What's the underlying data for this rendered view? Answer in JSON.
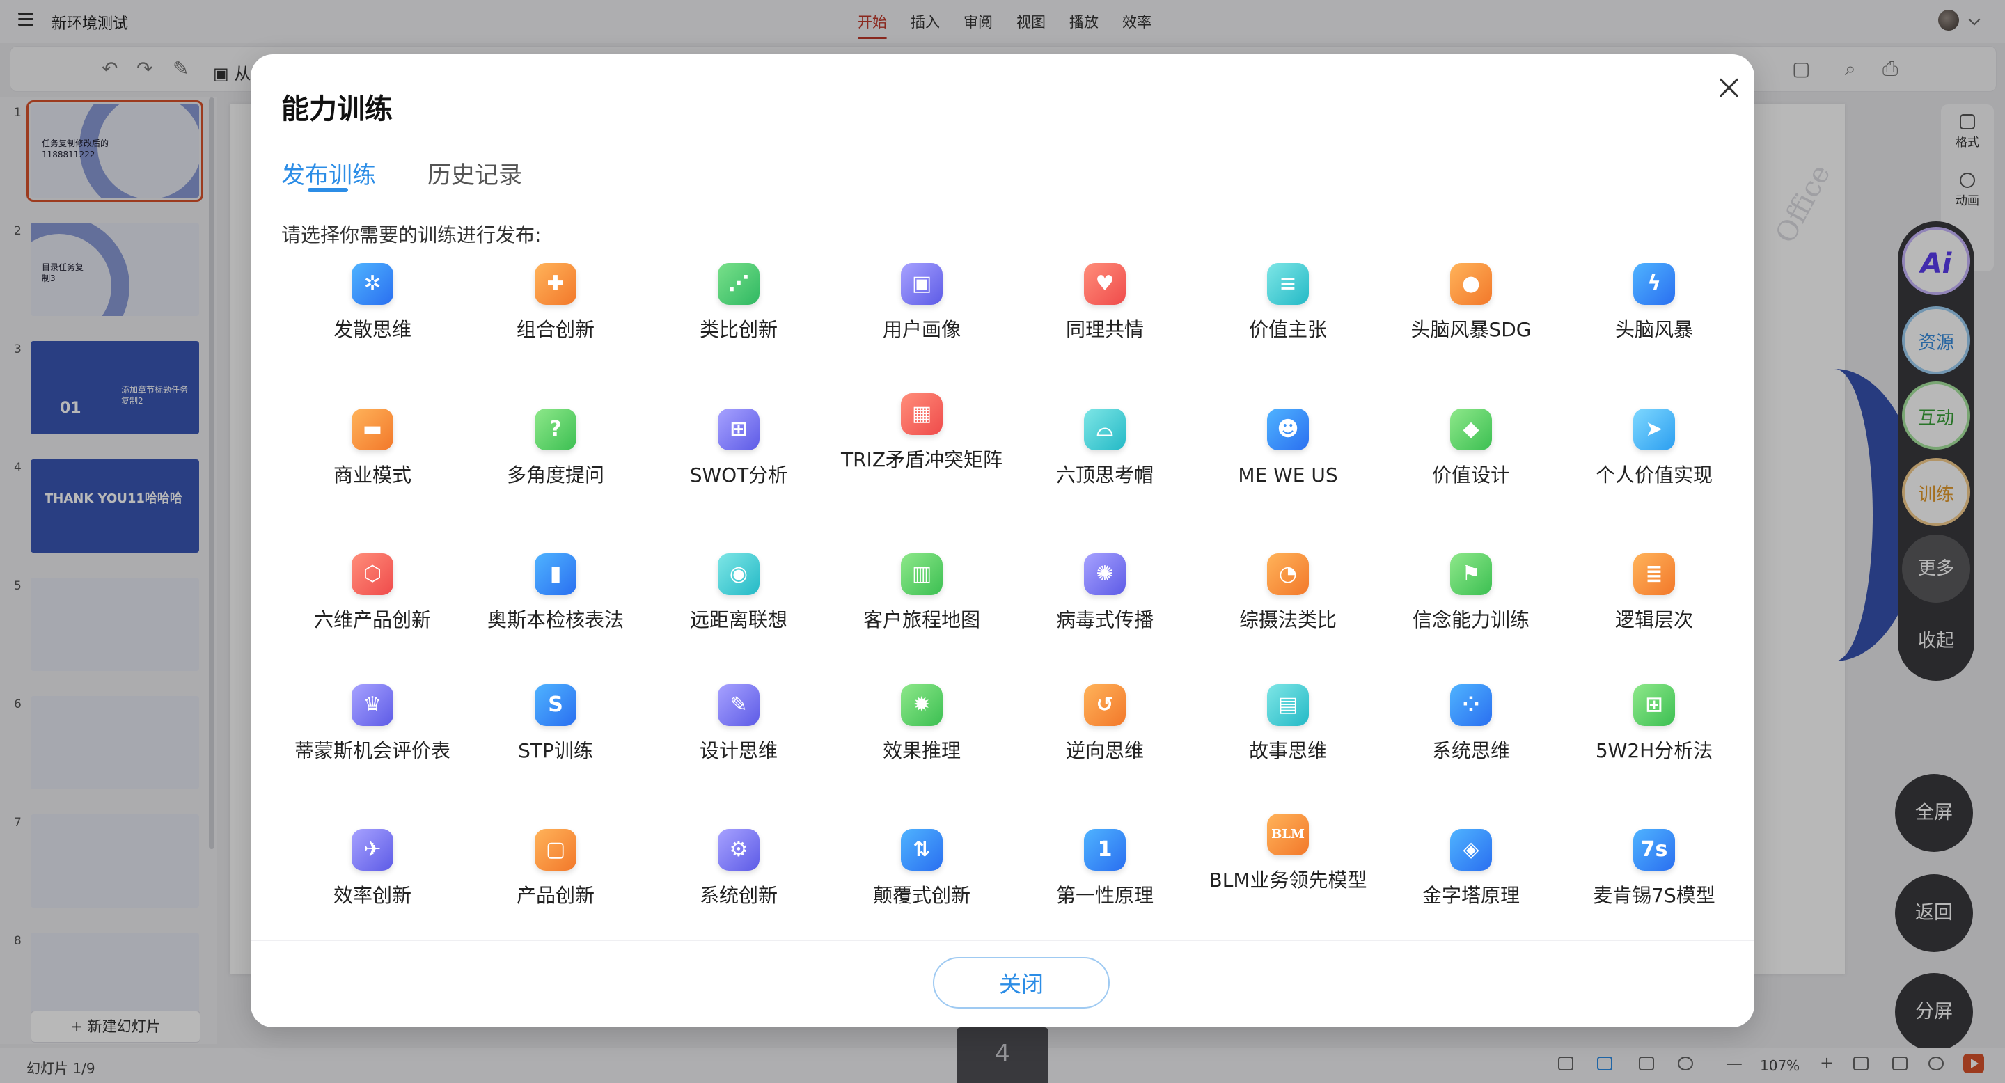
{
  "app": {
    "doc_title": "新环境测试",
    "tabs": [
      "开始",
      "插入",
      "审阅",
      "视图",
      "播放",
      "效率"
    ],
    "active_tab": "开始"
  },
  "toolbar": {
    "partial_label": "从"
  },
  "slides_panel": {
    "thumbnails": [
      {
        "num": "1",
        "text": "任务复制修改后的 1188811222"
      },
      {
        "num": "2",
        "text": "目录任务复制3"
      },
      {
        "num": "3",
        "big": "01",
        "text": "添加章节标题任务复制2"
      },
      {
        "num": "4",
        "big": "THANK YOU11哈哈哈"
      },
      {
        "num": "5",
        "text": ""
      },
      {
        "num": "6",
        "text": ""
      },
      {
        "num": "7",
        "text": ""
      },
      {
        "num": "8",
        "text": ""
      }
    ],
    "new_slide_label": "+ 新建幻灯片"
  },
  "right_panel": {
    "format": "格式",
    "animation": "动画"
  },
  "float_bar": {
    "ai": "Ai",
    "resources": "资源",
    "interact": "互动",
    "training": "训练",
    "more": "更多",
    "collapse": "收起",
    "fullscreen": "全屏",
    "back": "返回",
    "split": "分屏"
  },
  "status_bar": {
    "slide_counter": "幻灯片 1/9",
    "page_tab": "4",
    "zoom": "107%"
  },
  "modal": {
    "title": "能力训练",
    "tab_publish": "发布训练",
    "tab_history": "历史记录",
    "prompt": "请选择你需要的训练进行发布:",
    "close_button": "关闭",
    "items": [
      {
        "label": "发散思维",
        "icon": "network-icon",
        "color": "blue",
        "glyph": "✲"
      },
      {
        "label": "组合创新",
        "icon": "puzzle-icon",
        "color": "orange",
        "glyph": "✚"
      },
      {
        "label": "类比创新",
        "icon": "nodes-icon",
        "color": "green",
        "glyph": "⋰"
      },
      {
        "label": "用户画像",
        "icon": "user-card-icon",
        "color": "purple",
        "glyph": "▣"
      },
      {
        "label": "同理共情",
        "icon": "heart-icon",
        "color": "red",
        "glyph": "♥"
      },
      {
        "label": "价值主张",
        "icon": "database-icon",
        "color": "cyan",
        "glyph": "≡"
      },
      {
        "label": "头脑风暴SDG",
        "icon": "bulb-icon",
        "color": "orange",
        "glyph": "●"
      },
      {
        "label": "头脑风暴",
        "icon": "bolt-icon",
        "color": "blue",
        "glyph": "ϟ"
      },
      {
        "label": "商业模式",
        "icon": "briefcase-icon",
        "color": "orange",
        "glyph": "▬"
      },
      {
        "label": "多角度提问",
        "icon": "question-icon",
        "color": "lime",
        "glyph": "?"
      },
      {
        "label": "SWOT分析",
        "icon": "swot-grid-icon",
        "color": "purple",
        "glyph": "⊞"
      },
      {
        "label": "TRIZ矛盾冲突矩阵",
        "icon": "matrix-icon",
        "color": "red",
        "glyph": "▦"
      },
      {
        "label": "六顶思考帽",
        "icon": "hat-icon",
        "color": "cyan",
        "glyph": "⌓"
      },
      {
        "label": "ME WE US",
        "icon": "group-icon",
        "color": "blue",
        "glyph": "☻"
      },
      {
        "label": "价值设计",
        "icon": "diamond-icon",
        "color": "lime",
        "glyph": "◆"
      },
      {
        "label": "个人价值实现",
        "icon": "paper-plane-icon",
        "color": "sky",
        "glyph": "➤"
      },
      {
        "label": "六维产品创新",
        "icon": "hexagon-icon",
        "color": "red",
        "glyph": "⬡"
      },
      {
        "label": "奥斯本检核表法",
        "icon": "bar-chart-icon",
        "color": "blue",
        "glyph": "▮"
      },
      {
        "label": "远距离联想",
        "icon": "location-pin-icon",
        "color": "cyan",
        "glyph": "◉"
      },
      {
        "label": "客户旅程地图",
        "icon": "map-icon",
        "color": "lime",
        "glyph": "▥"
      },
      {
        "label": "病毒式传播",
        "icon": "virus-icon",
        "color": "purple",
        "glyph": "✺"
      },
      {
        "label": "综摄法类比",
        "icon": "pie-chart-icon",
        "color": "orange",
        "glyph": "◔"
      },
      {
        "label": "信念能力训练",
        "icon": "flag-icon",
        "color": "lime",
        "glyph": "⚑"
      },
      {
        "label": "逻辑层次",
        "icon": "layers-icon",
        "color": "orange",
        "glyph": "≣"
      },
      {
        "label": "蒂蒙斯机会评价表",
        "icon": "crown-chart-icon",
        "color": "purple",
        "glyph": "♛"
      },
      {
        "label": "STP训练",
        "icon": "letter-s-icon",
        "color": "blue",
        "glyph": "S"
      },
      {
        "label": "设计思维",
        "icon": "ruler-pencil-icon",
        "color": "purple",
        "glyph": "✎"
      },
      {
        "label": "效果推理",
        "icon": "lightbulb-icon",
        "color": "lime",
        "glyph": "✹"
      },
      {
        "label": "逆向思维",
        "icon": "reverse-arrow-icon",
        "color": "orange",
        "glyph": "↺"
      },
      {
        "label": "故事思维",
        "icon": "book-icon",
        "color": "cyan",
        "glyph": "▤"
      },
      {
        "label": "系统思维",
        "icon": "four-squares-icon",
        "color": "blue",
        "glyph": "⁘"
      },
      {
        "label": "5W2H分析法",
        "icon": "tiles-icon",
        "color": "lime",
        "glyph": "⊞"
      },
      {
        "label": "效率创新",
        "icon": "rocket-icon",
        "color": "purple",
        "glyph": "✈"
      },
      {
        "label": "产品创新",
        "icon": "box-icon",
        "color": "orange",
        "glyph": "▢"
      },
      {
        "label": "系统创新",
        "icon": "gear-icon",
        "color": "purple",
        "glyph": "⚙"
      },
      {
        "label": "颠覆式创新",
        "icon": "swap-arrows-icon",
        "color": "blue",
        "glyph": "⇅"
      },
      {
        "label": "第一性原理",
        "icon": "number-one-icon",
        "color": "blue",
        "glyph": "1"
      },
      {
        "label": "BLM业务领先模型",
        "icon": "blm-badge-icon",
        "color": "orange",
        "glyph": "BLM"
      },
      {
        "label": "金字塔原理",
        "icon": "stack-icon",
        "color": "blue",
        "glyph": "◈"
      },
      {
        "label": "麦肯锡7S模型",
        "icon": "seven-s-icon",
        "color": "blue",
        "glyph": "7s"
      }
    ]
  }
}
